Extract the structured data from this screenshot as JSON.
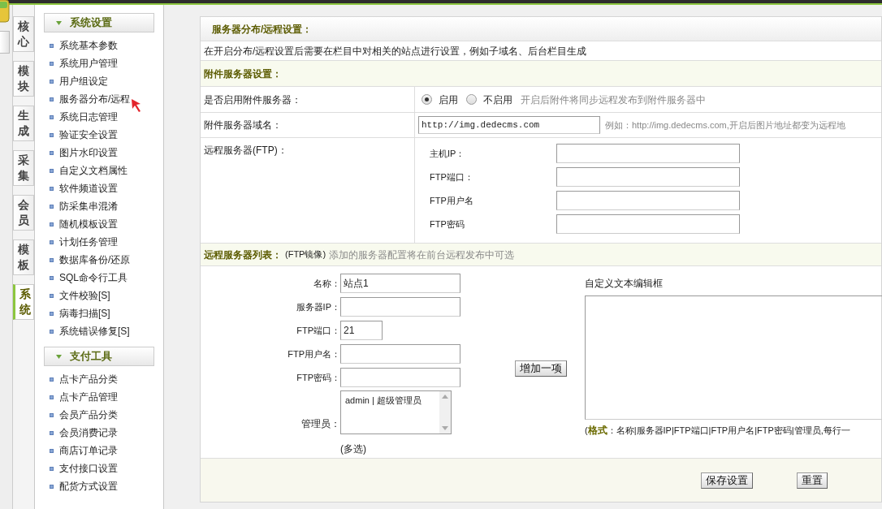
{
  "vertical_tabs": [
    {
      "label": "核心",
      "selected": false
    },
    {
      "label": "模块",
      "selected": false
    },
    {
      "label": "生成",
      "selected": false
    },
    {
      "label": "采集",
      "selected": false
    },
    {
      "label": "会员",
      "selected": false
    },
    {
      "label": "模板",
      "selected": false
    },
    {
      "label": "系统",
      "selected": true
    }
  ],
  "sidebar": {
    "sections": [
      {
        "title": "系统设置",
        "expanded": true,
        "items": [
          {
            "label": "系统基本参数"
          },
          {
            "label": "系统用户管理"
          },
          {
            "label": "用户组设定"
          },
          {
            "label": "服务器分布/远程",
            "pointer": true
          },
          {
            "label": "系统日志管理"
          },
          {
            "label": "验证安全设置"
          },
          {
            "label": "图片水印设置"
          },
          {
            "label": "自定义文档属性"
          },
          {
            "label": "软件频道设置"
          },
          {
            "label": "防采集串混淆"
          },
          {
            "label": "随机模板设置"
          },
          {
            "label": "计划任务管理"
          },
          {
            "label": "数据库备份/还原"
          },
          {
            "label": "SQL命令行工具"
          },
          {
            "label": "文件校验[S]"
          },
          {
            "label": "病毒扫描[S]"
          },
          {
            "label": "系统错误修复[S]"
          }
        ]
      },
      {
        "title": "支付工具",
        "expanded": true,
        "items": [
          {
            "label": "点卡产品分类"
          },
          {
            "label": "点卡产品管理"
          },
          {
            "label": "会员产品分类"
          },
          {
            "label": "会员消费记录"
          },
          {
            "label": "商店订单记录"
          },
          {
            "label": "支付接口设置"
          },
          {
            "label": "配货方式设置"
          }
        ]
      }
    ]
  },
  "panel": {
    "title": "服务器分布/远程设置：",
    "notice": "在开启分布/远程设置后需要在栏目中对相关的站点进行设置，例如子域名、后台栏目生成",
    "attachment_section": "附件服务器设置：",
    "enable_row": {
      "label": "是否启用附件服务器：",
      "options": [
        {
          "label": "启用",
          "selected": true
        },
        {
          "label": "不启用",
          "selected": false
        }
      ],
      "hint": "开启后附件将同步远程发布到附件服务器中"
    },
    "domain_row": {
      "label": "附件服务器域名：",
      "value": "http://img.dedecms.com",
      "hint": "例如：http://img.dedecms.com,开启后图片地址都变为远程地"
    },
    "ftp_row": {
      "label": "远程服务器(FTP)：",
      "fields": [
        {
          "label": "主机IP："
        },
        {
          "label": "FTP端口："
        },
        {
          "label": "FTP用户名"
        },
        {
          "label": "FTP密码"
        }
      ]
    },
    "list_header": {
      "title": "远程服务器列表：",
      "note": "(FTP镜像)",
      "hint": "添加的服务器配置将在前台远程发布中可选"
    },
    "server_form": {
      "fields": [
        {
          "label": "名称：",
          "value": "站点1",
          "kind": "text"
        },
        {
          "label": "服务器IP：",
          "kind": "text"
        },
        {
          "label": "FTP端口：",
          "value": "21",
          "kind": "short"
        },
        {
          "label": "FTP用户名：",
          "kind": "text"
        },
        {
          "label": "FTP密码：",
          "kind": "text"
        }
      ],
      "admin": {
        "label": "管理员：",
        "options": [
          "admin | 超级管理员"
        ],
        "note": "(多选)"
      },
      "add_button": "增加一项",
      "editor_label": "自定义文本编辑框",
      "format": "(**格式**：名称|服务器IP|FTP端口|FTP用户名|FTP密码|管理员,每行一"
    },
    "buttons": [
      "保存设置",
      "重置"
    ]
  }
}
